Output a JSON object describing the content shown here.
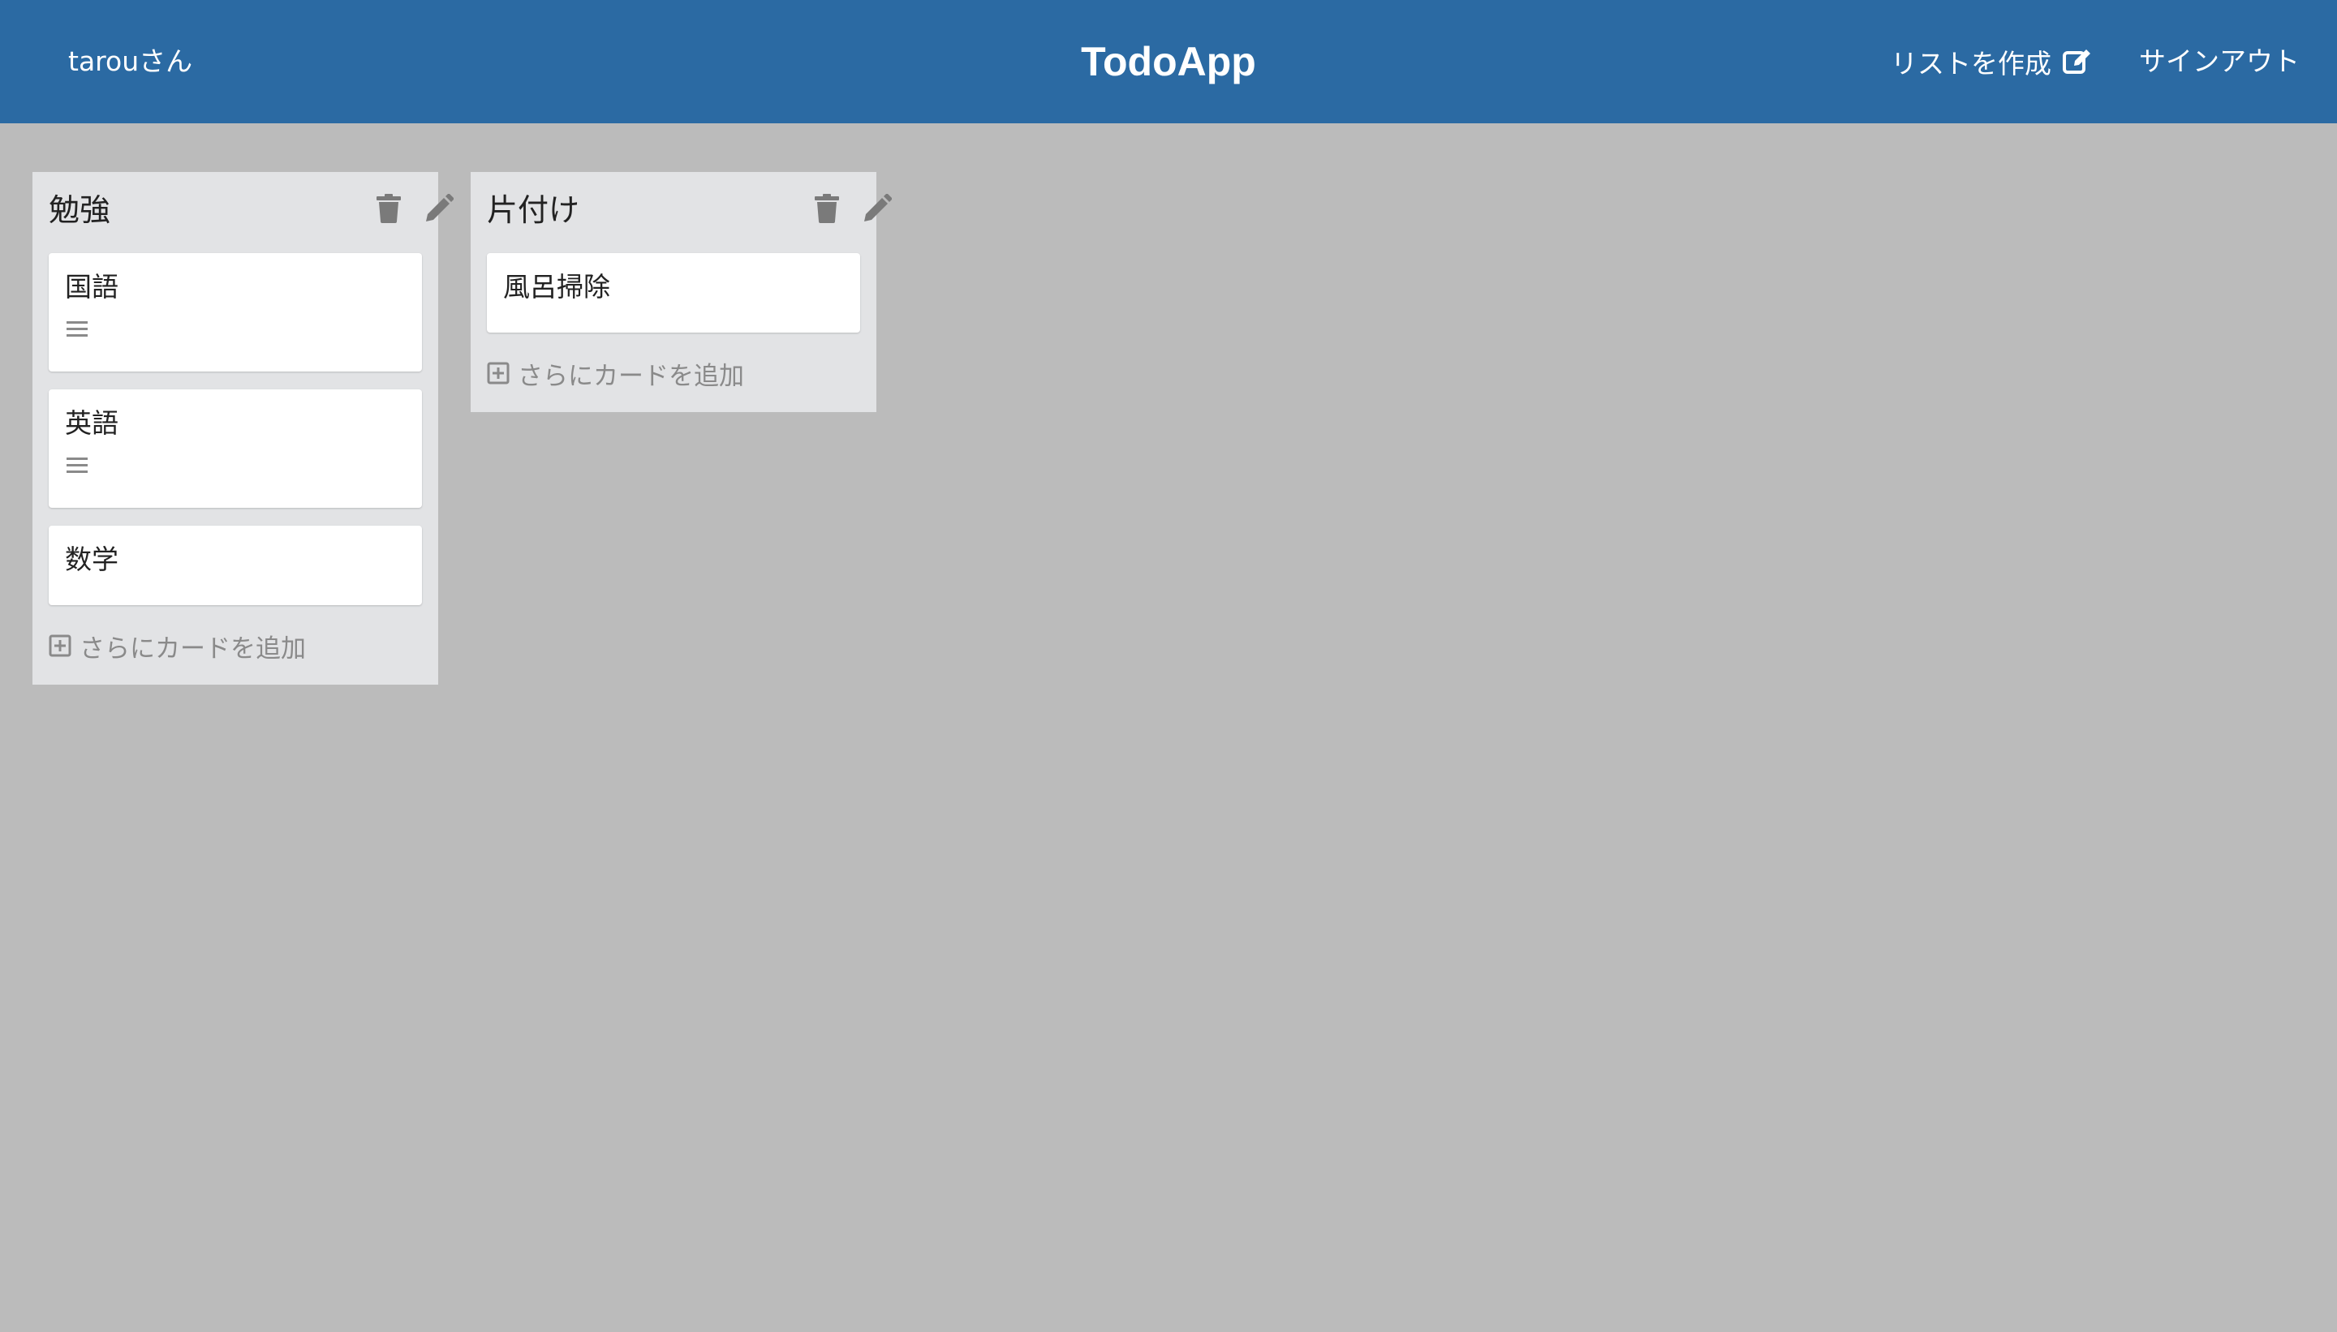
{
  "header": {
    "user_label": "tarouさん",
    "app_title": "TodoApp",
    "create_list_label": "リストを作成",
    "create_list_icon": "edit-square-icon",
    "sign_out_label": "サインアウト",
    "background_color": "#2b6aa3"
  },
  "board": {
    "background_color": "#bbbbbb",
    "lists": [
      {
        "title": "勉強",
        "delete_icon": "trash-icon",
        "edit_icon": "pencil-icon",
        "cards": [
          {
            "title": "国語",
            "has_description": true
          },
          {
            "title": "英語",
            "has_description": true
          },
          {
            "title": "数学",
            "has_description": false
          }
        ],
        "add_card_label": "さらにカードを追加"
      },
      {
        "title": "片付け",
        "delete_icon": "trash-icon",
        "edit_icon": "pencil-icon",
        "cards": [
          {
            "title": "風呂掃除",
            "has_description": false
          }
        ],
        "add_card_label": "さらにカードを追加"
      }
    ]
  }
}
